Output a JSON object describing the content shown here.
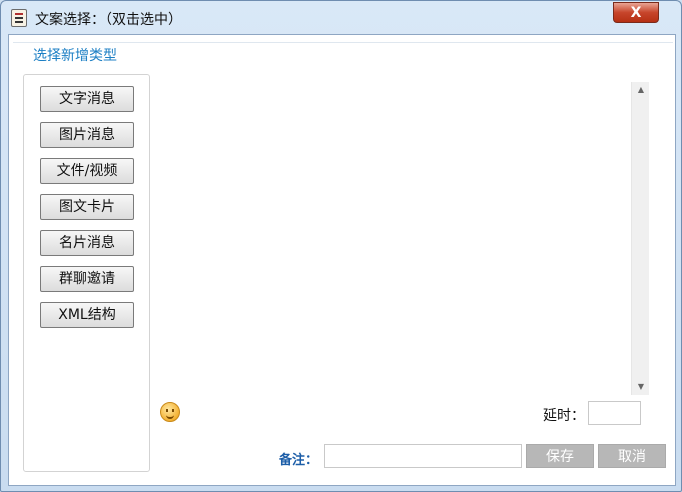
{
  "window": {
    "title": "文案选择：（双击选中）",
    "close_label": "X"
  },
  "section": {
    "label": "选择新增类型"
  },
  "types": [
    {
      "label": "文字消息"
    },
    {
      "label": "图片消息"
    },
    {
      "label": "文件/视频"
    },
    {
      "label": "图文卡片"
    },
    {
      "label": "名片消息"
    },
    {
      "label": "群聊邀请"
    },
    {
      "label": "XML结构"
    }
  ],
  "delay": {
    "label": "延时：",
    "value": ""
  },
  "remark": {
    "label": "备注：",
    "value": ""
  },
  "buttons": {
    "save_label": "保存",
    "cancel_label": "取消"
  },
  "icons": {
    "app": "document-icon",
    "emoji": "smiley-icon",
    "scroll_up": "chevron-up-icon",
    "scroll_down": "chevron-down-icon"
  },
  "colors": {
    "accent": "#1c7fc4",
    "remark_label": "#1d5ea8",
    "action_button": "#b7b7b7",
    "close_button": "#c7452b"
  }
}
